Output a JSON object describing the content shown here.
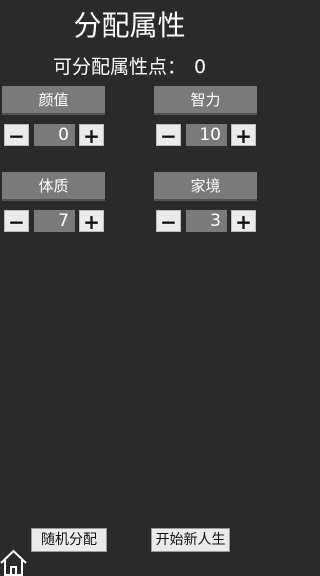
{
  "title": "分配属性",
  "points_label": "可分配属性点：",
  "points_value": "0",
  "attributes": [
    {
      "label": "颜值",
      "value": "0",
      "minus": "−",
      "plus": "+"
    },
    {
      "label": "智力",
      "value": "10",
      "minus": "−",
      "plus": "+"
    },
    {
      "label": "体质",
      "value": "7",
      "minus": "−",
      "plus": "+"
    },
    {
      "label": "家境",
      "value": "3",
      "minus": "−",
      "plus": "+"
    }
  ],
  "buttons": {
    "random": "随机分配",
    "start": "开始新人生"
  },
  "icons": {
    "home": "home-icon"
  },
  "colors": {
    "background": "#2b2a2a",
    "label_bg": "#7a7a7a",
    "button_bg": "#ebebeb"
  }
}
